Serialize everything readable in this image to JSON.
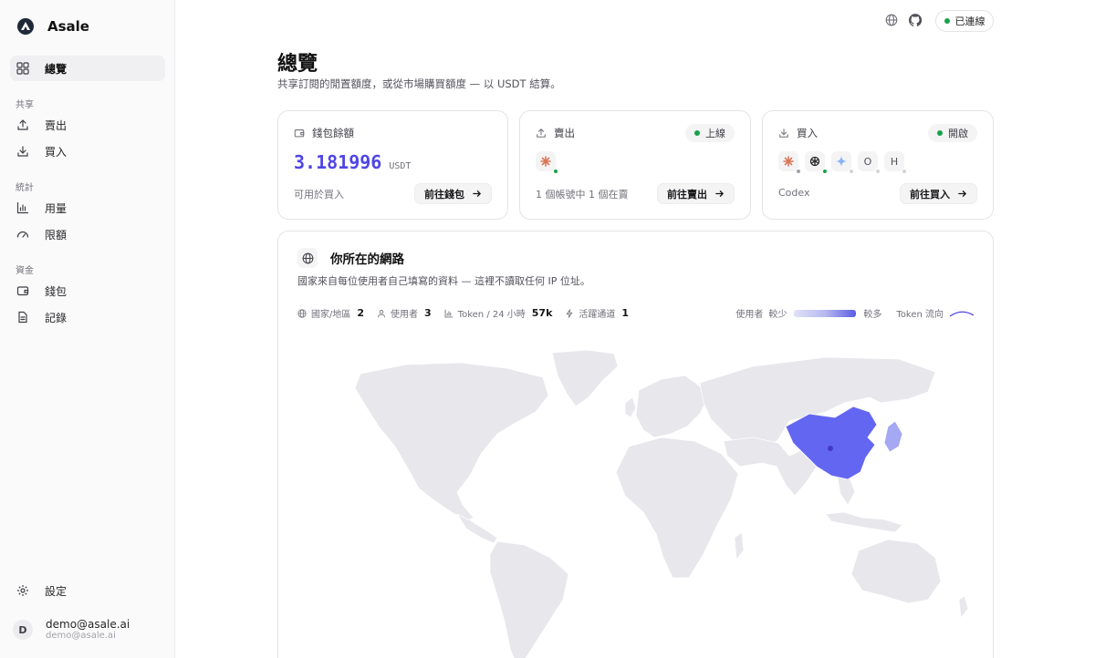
{
  "app": {
    "name": "Asale"
  },
  "sidebar": {
    "overview": "總覽",
    "section_share": "共享",
    "sell": "賣出",
    "buy": "買入",
    "section_stats": "統計",
    "usage": "用量",
    "limits": "限額",
    "section_funds": "資金",
    "wallet": "錢包",
    "records": "記錄",
    "settings": "設定"
  },
  "user": {
    "initial": "D",
    "name": "demo@asale.ai",
    "email": "demo@asale.ai"
  },
  "topbar": {
    "status": "已連線",
    "status_color": "#16a34a",
    "icons": [
      "globe-icon",
      "github-icon"
    ]
  },
  "header": {
    "title": "總覽",
    "subtitle": "共享訂閱的閒置額度，或從市場購買額度 — 以 USDT 結算。"
  },
  "wallet_card": {
    "title": "錢包餘額",
    "balance": "3.181996",
    "unit": "USDT",
    "note": "可用於買入",
    "button": "前往錢包"
  },
  "sell_card": {
    "title": "賣出",
    "badge": "上線",
    "note": "1 個帳號中 1 個在賣",
    "button": "前往賣出"
  },
  "buy_card": {
    "title": "買入",
    "badge": "開啟",
    "note": "Codex",
    "button": "前往買入",
    "providers": [
      {
        "icon": "claude-icon",
        "status": "offline"
      },
      {
        "icon": "openai-icon",
        "status": "online"
      },
      {
        "icon": "gemini-icon",
        "status": "offline"
      },
      {
        "letter": "O",
        "status": "offline"
      },
      {
        "letter": "H",
        "status": "offline"
      }
    ]
  },
  "network": {
    "title": "你所在的網路",
    "subtitle": "國家來自每位使用者自己填寫的資料 — 這裡不讀取任何 IP 位址。",
    "stats": {
      "countries_label": "國家/地區",
      "countries_value": "2",
      "users_label": "使用者",
      "users_value": "3",
      "tokens_label": "Token / 24 小時",
      "tokens_value": "57k",
      "channels_label": "活躍通道",
      "channels_value": "1"
    },
    "legend": {
      "users": "使用者",
      "less": "較少",
      "more": "較多",
      "flow": "Token 流向"
    },
    "highlighted_countries": [
      {
        "name": "China",
        "level": "high",
        "color": "#6366f1"
      },
      {
        "name": "Japan",
        "level": "low",
        "color": "#a5a8f2"
      }
    ]
  },
  "colors": {
    "accent": "#4f46e5",
    "online": "#16a34a",
    "map_land": "#e7e7ec",
    "map_high": "#6366f1"
  }
}
